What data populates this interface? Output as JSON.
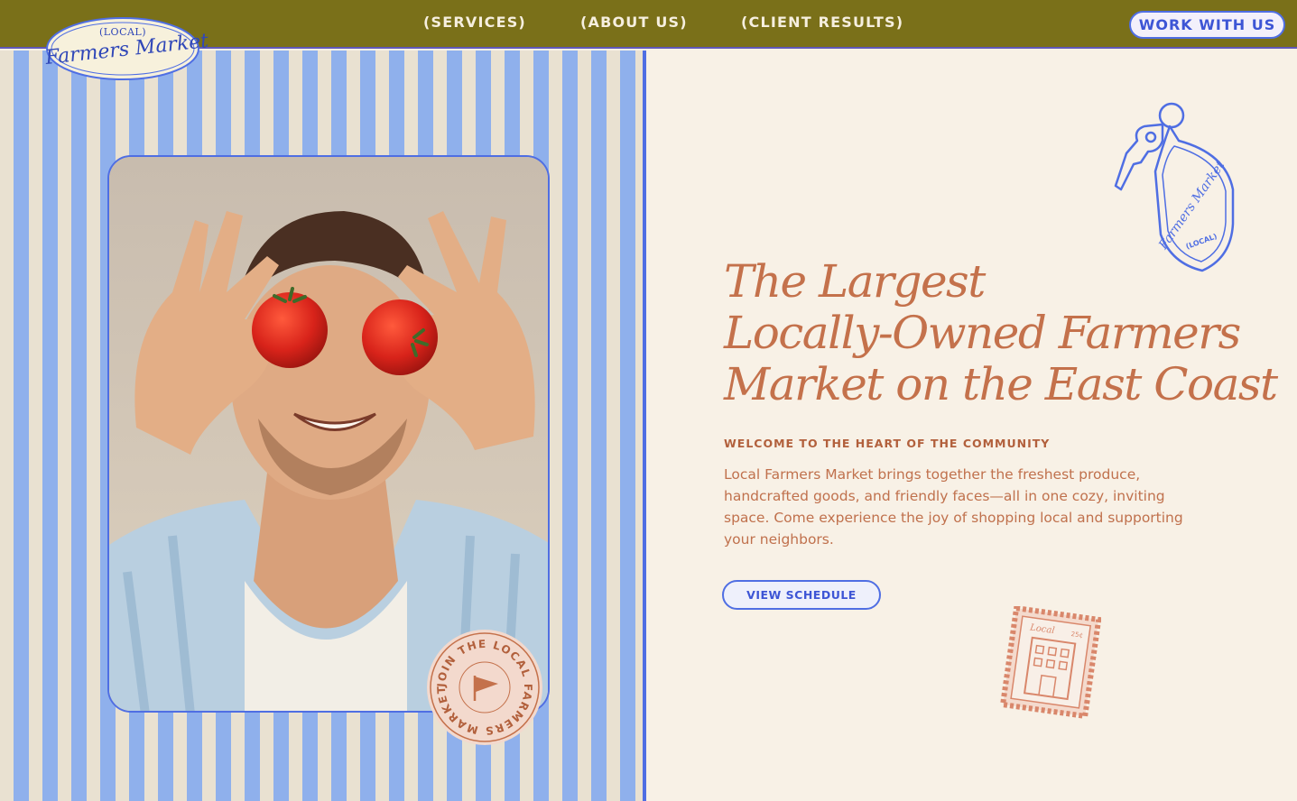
{
  "nav": {
    "links": [
      "(SERVICES)",
      "(ABOUT US)",
      "(CLIENT RESULTS)"
    ],
    "cta": "WORK WITH US"
  },
  "logo": {
    "top": "(LOCAL)",
    "script": "Farmers Market"
  },
  "hero": {
    "headline_lines": [
      "The Largest",
      "Locally-Owned Farmers",
      "Market on the East Coast"
    ],
    "eyebrow": "WELCOME TO THE HEART OF THE COMMUNITY",
    "body": "Local Farmers Market brings together the freshest produce, handcrafted goods, and friendly faces—all in one cozy, inviting space. Come experience the joy of shopping local and supporting your neighbors.",
    "button": "VIEW SCHEDULE"
  },
  "circle_stamp": {
    "text": "JOIN THE LOCAL FARMERS MARKET"
  },
  "keytag": {
    "script": "Farmers Market",
    "small": "(LOCAL)"
  },
  "postage": {
    "script": "Local",
    "value": "25¢"
  },
  "colors": {
    "topbar": "#7a7019",
    "accent_blue": "#4f6ee3",
    "terracotta": "#c4714b",
    "cream": "#f8f1e6",
    "stripe_blue": "#8fb0ec"
  }
}
